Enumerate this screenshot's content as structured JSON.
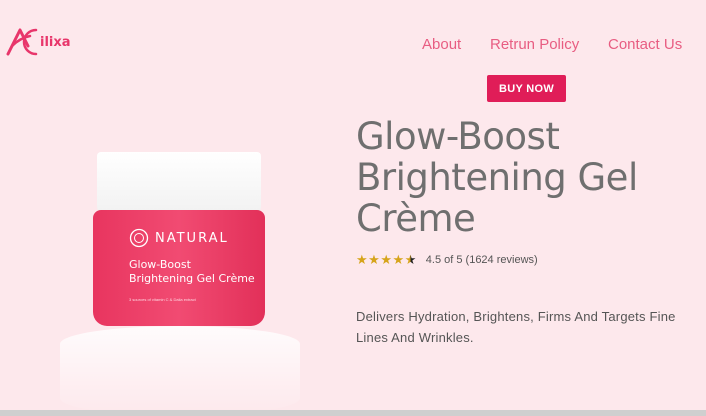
{
  "brand": {
    "logo_text": "ilixa"
  },
  "nav": {
    "about": "About",
    "return_policy": "Retrun Policy",
    "contact": "Contact Us"
  },
  "cta": {
    "buy_now": "BUY NOW"
  },
  "product": {
    "title": "Glow-Boost Brightening Gel Crème",
    "rating": 4.5,
    "rating_text": "4.5 of 5 (1624 reviews)",
    "description": "Delivers Hydration, Brightens, Firms And Targets Fine Lines And Wrinkles.",
    "jar_brand": "NATURAL",
    "jar_name_line1": "Glow-Boost",
    "jar_name_line2": "Brightening Gel Crème",
    "jar_subtext": "3 sources of vitamin C & Dalia extract"
  },
  "colors": {
    "accent": "#e01d58",
    "nav_text": "#e85d82",
    "background": "#fde8ec"
  }
}
